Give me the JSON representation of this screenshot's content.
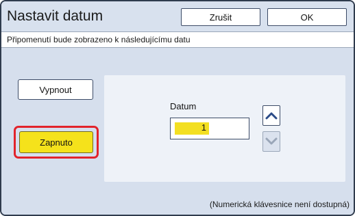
{
  "header": {
    "title": "Nastavit datum",
    "cancel_label": "Zrušit",
    "ok_label": "OK"
  },
  "subtitle": "Připomenutí bude zobrazeno k následujícímu datu",
  "options": {
    "off_label": "Vypnout",
    "on_label": "Zapnuto",
    "selected": "Zapnuto"
  },
  "date": {
    "label": "Datum",
    "value": "1",
    "up_icon": "chevron-up-icon",
    "down_icon": "chevron-down-icon"
  },
  "footer": {
    "hint": "(Numerická klávesnice není dostupná)"
  },
  "colors": {
    "accent_yellow": "#f5e21b",
    "selection_red": "#e2232b"
  }
}
